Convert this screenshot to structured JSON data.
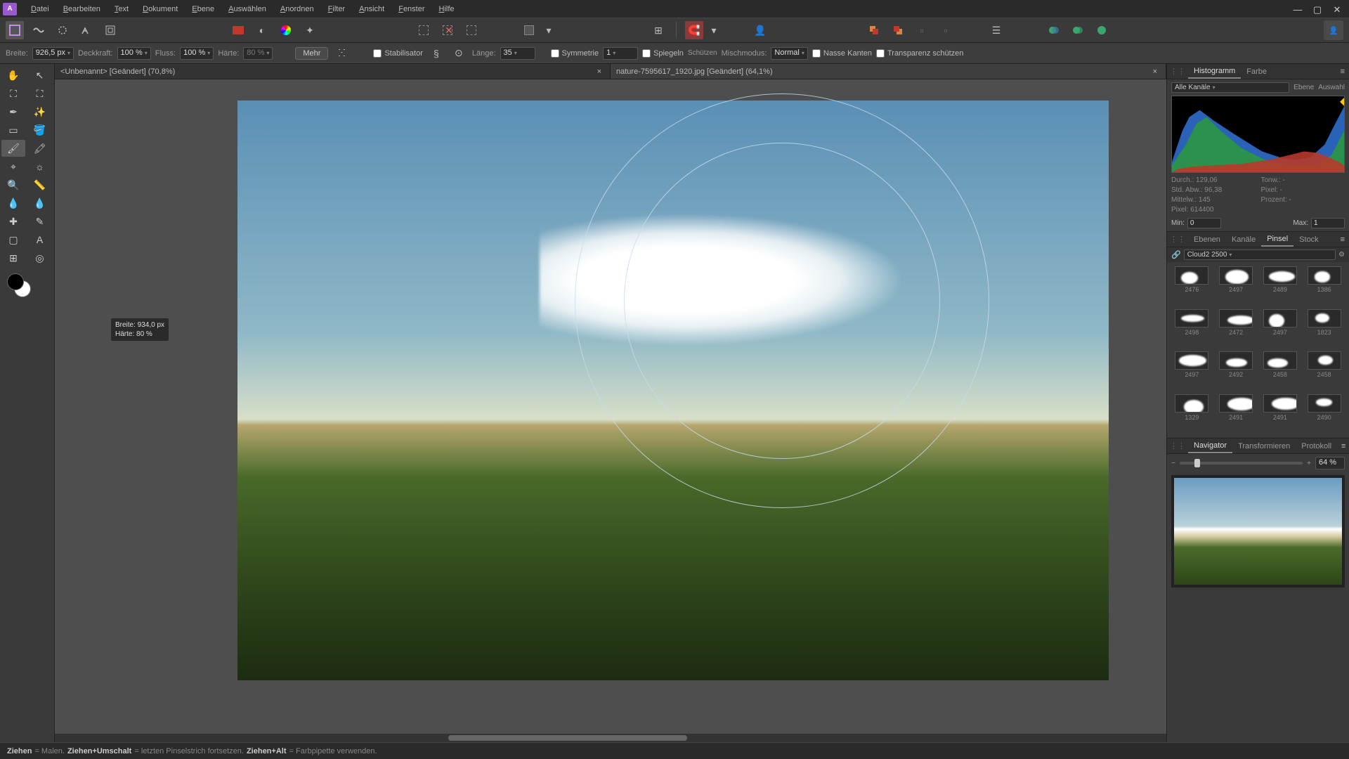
{
  "menu": [
    "Datei",
    "Bearbeiten",
    "Text",
    "Dokument",
    "Ebene",
    "Auswählen",
    "Anordnen",
    "Filter",
    "Ansicht",
    "Fenster",
    "Hilfe"
  ],
  "context": {
    "breite_label": "Breite:",
    "breite": "926,5 px",
    "deckkraft_label": "Deckkraft:",
    "deckkraft": "100 %",
    "fluss_label": "Fluss:",
    "fluss": "100 %",
    "haerte_label": "Härte:",
    "haerte": "80 %",
    "mehr": "Mehr",
    "stabilisator": "Stabilisator",
    "laenge_label": "Länge:",
    "laenge": "35",
    "symmetrie": "Symmetrie",
    "sym_val": "1",
    "spiegeln": "Spiegeln",
    "schuetzen": "Schützen",
    "mischmodus_label": "Mischmodus:",
    "mischmodus": "Normal",
    "nasse": "Nasse Kanten",
    "transparenz": "Transparenz schützen"
  },
  "tabs": [
    {
      "title": "<Unbenannt> [Geändert] (70,8%)",
      "active": false
    },
    {
      "title": "nature-7595617_1920.jpg [Geändert] (64,1%)",
      "active": true
    }
  ],
  "tooltip": {
    "l1": "Breite: 934,0 px",
    "l2": "Härte: 80 %"
  },
  "histo": {
    "tabs": [
      "Histogramm",
      "Farbe"
    ],
    "channel": "Alle Kanäle",
    "ebene": "Ebene",
    "auswahl": "Auswahl",
    "stats": {
      "durch": "Durch.: 129,06",
      "tonw": "Tonw.: -",
      "std": "Std. Abw.: 96,38",
      "pixel2": "Pixel: -",
      "mittel": "Mittelw.: 145",
      "prozent": "Prozent: -",
      "pixel": "Pixel: 614400"
    },
    "min_label": "Min:",
    "min": "0",
    "max_label": "Max:",
    "max": "1"
  },
  "layers_tabs": [
    "Ebenen",
    "Kanäle",
    "Pinsel",
    "Stock"
  ],
  "brush_set": "Cloud2 2500",
  "brushes": [
    "2476",
    "2497",
    "2489",
    "1386",
    "2498",
    "2472",
    "2497",
    "1823",
    "2497",
    "2492",
    "2458",
    "2458",
    "1329",
    "2491",
    "2491",
    "2490"
  ],
  "nav_tabs": [
    "Navigator",
    "Transformieren",
    "Protokoll"
  ],
  "zoom": "64 %",
  "status": {
    "z1": "Ziehen",
    "t1": " = Malen. ",
    "z2": "Ziehen+Umschalt",
    "t2": " = letzten Pinselstrich fortsetzen. ",
    "z3": "Ziehen+Alt",
    "t3": " = Farbpipette verwenden."
  }
}
